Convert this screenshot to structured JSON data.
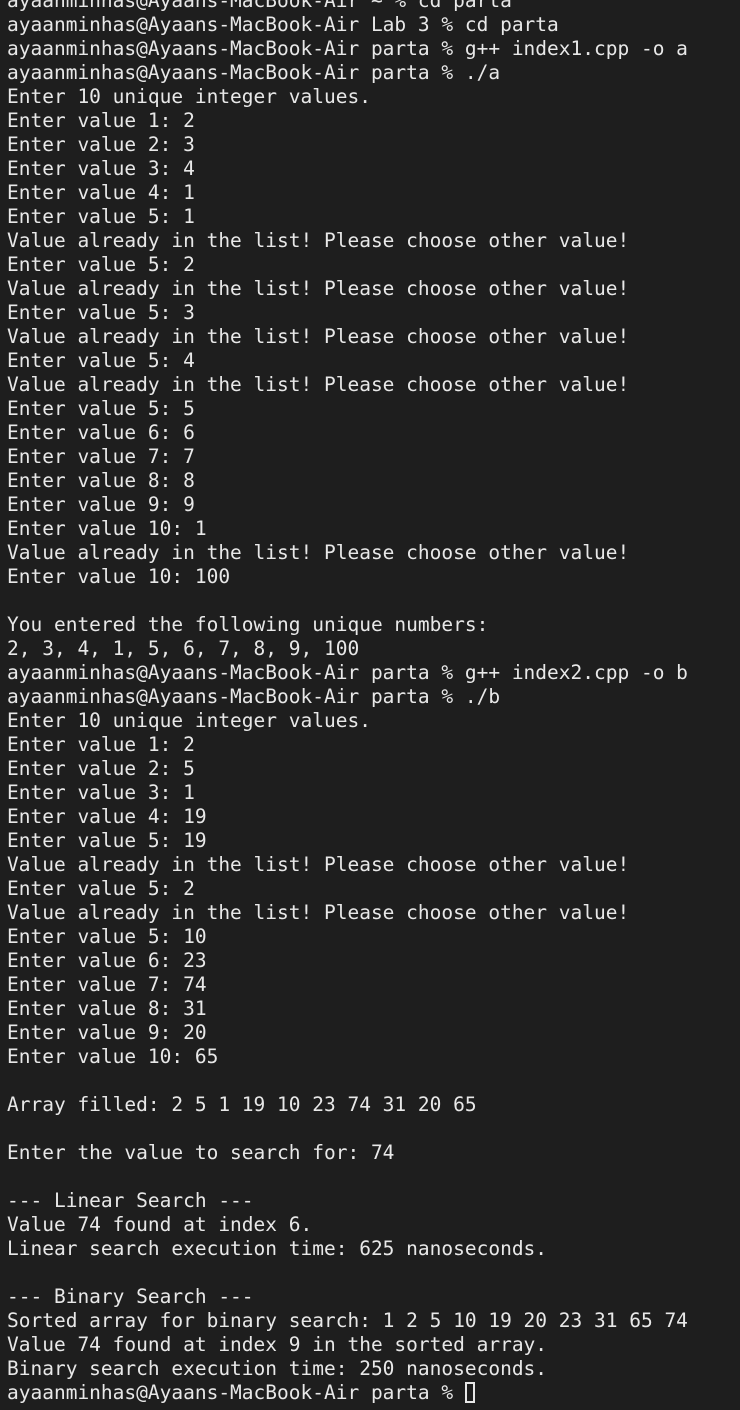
{
  "terminal": {
    "lines": [
      "ayaanminhas@Ayaans-MacBook-Air ~ % cd parta",
      "ayaanminhas@Ayaans-MacBook-Air Lab 3 % cd parta",
      "ayaanminhas@Ayaans-MacBook-Air parta % g++ index1.cpp -o a",
      "ayaanminhas@Ayaans-MacBook-Air parta % ./a",
      "Enter 10 unique integer values.",
      "Enter value 1: 2",
      "Enter value 2: 3",
      "Enter value 3: 4",
      "Enter value 4: 1",
      "Enter value 5: 1",
      "Value already in the list! Please choose other value!",
      "Enter value 5: 2",
      "Value already in the list! Please choose other value!",
      "Enter value 5: 3",
      "Value already in the list! Please choose other value!",
      "Enter value 5: 4",
      "Value already in the list! Please choose other value!",
      "Enter value 5: 5",
      "Enter value 6: 6",
      "Enter value 7: 7",
      "Enter value 8: 8",
      "Enter value 9: 9",
      "Enter value 10: 1",
      "Value already in the list! Please choose other value!",
      "Enter value 10: 100",
      "",
      "You entered the following unique numbers:",
      "2, 3, 4, 1, 5, 6, 7, 8, 9, 100",
      "ayaanminhas@Ayaans-MacBook-Air parta % g++ index2.cpp -o b",
      "ayaanminhas@Ayaans-MacBook-Air parta % ./b",
      "Enter 10 unique integer values.",
      "Enter value 1: 2",
      "Enter value 2: 5",
      "Enter value 3: 1",
      "Enter value 4: 19",
      "Enter value 5: 19",
      "Value already in the list! Please choose other value!",
      "Enter value 5: 2",
      "Value already in the list! Please choose other value!",
      "Enter value 5: 10",
      "Enter value 6: 23",
      "Enter value 7: 74",
      "Enter value 8: 31",
      "Enter value 9: 20",
      "Enter value 10: 65",
      "",
      "Array filled: 2 5 1 19 10 23 74 31 20 65",
      "",
      "Enter the value to search for: 74",
      "",
      "--- Linear Search ---",
      "Value 74 found at index 6.",
      "Linear search execution time: 625 nanoseconds.",
      "",
      "--- Binary Search ---",
      "Sorted array for binary search: 1 2 5 10 19 20 23 31 65 74",
      "Value 74 found at index 9 in the sorted array.",
      "Binary search execution time: 250 nanoseconds."
    ],
    "prompt": "ayaanminhas@Ayaans-MacBook-Air parta % ",
    "cursor_icon": "block-cursor-outline"
  },
  "colors": {
    "background": "#1e1e1e",
    "text": "#e8e8e8"
  }
}
